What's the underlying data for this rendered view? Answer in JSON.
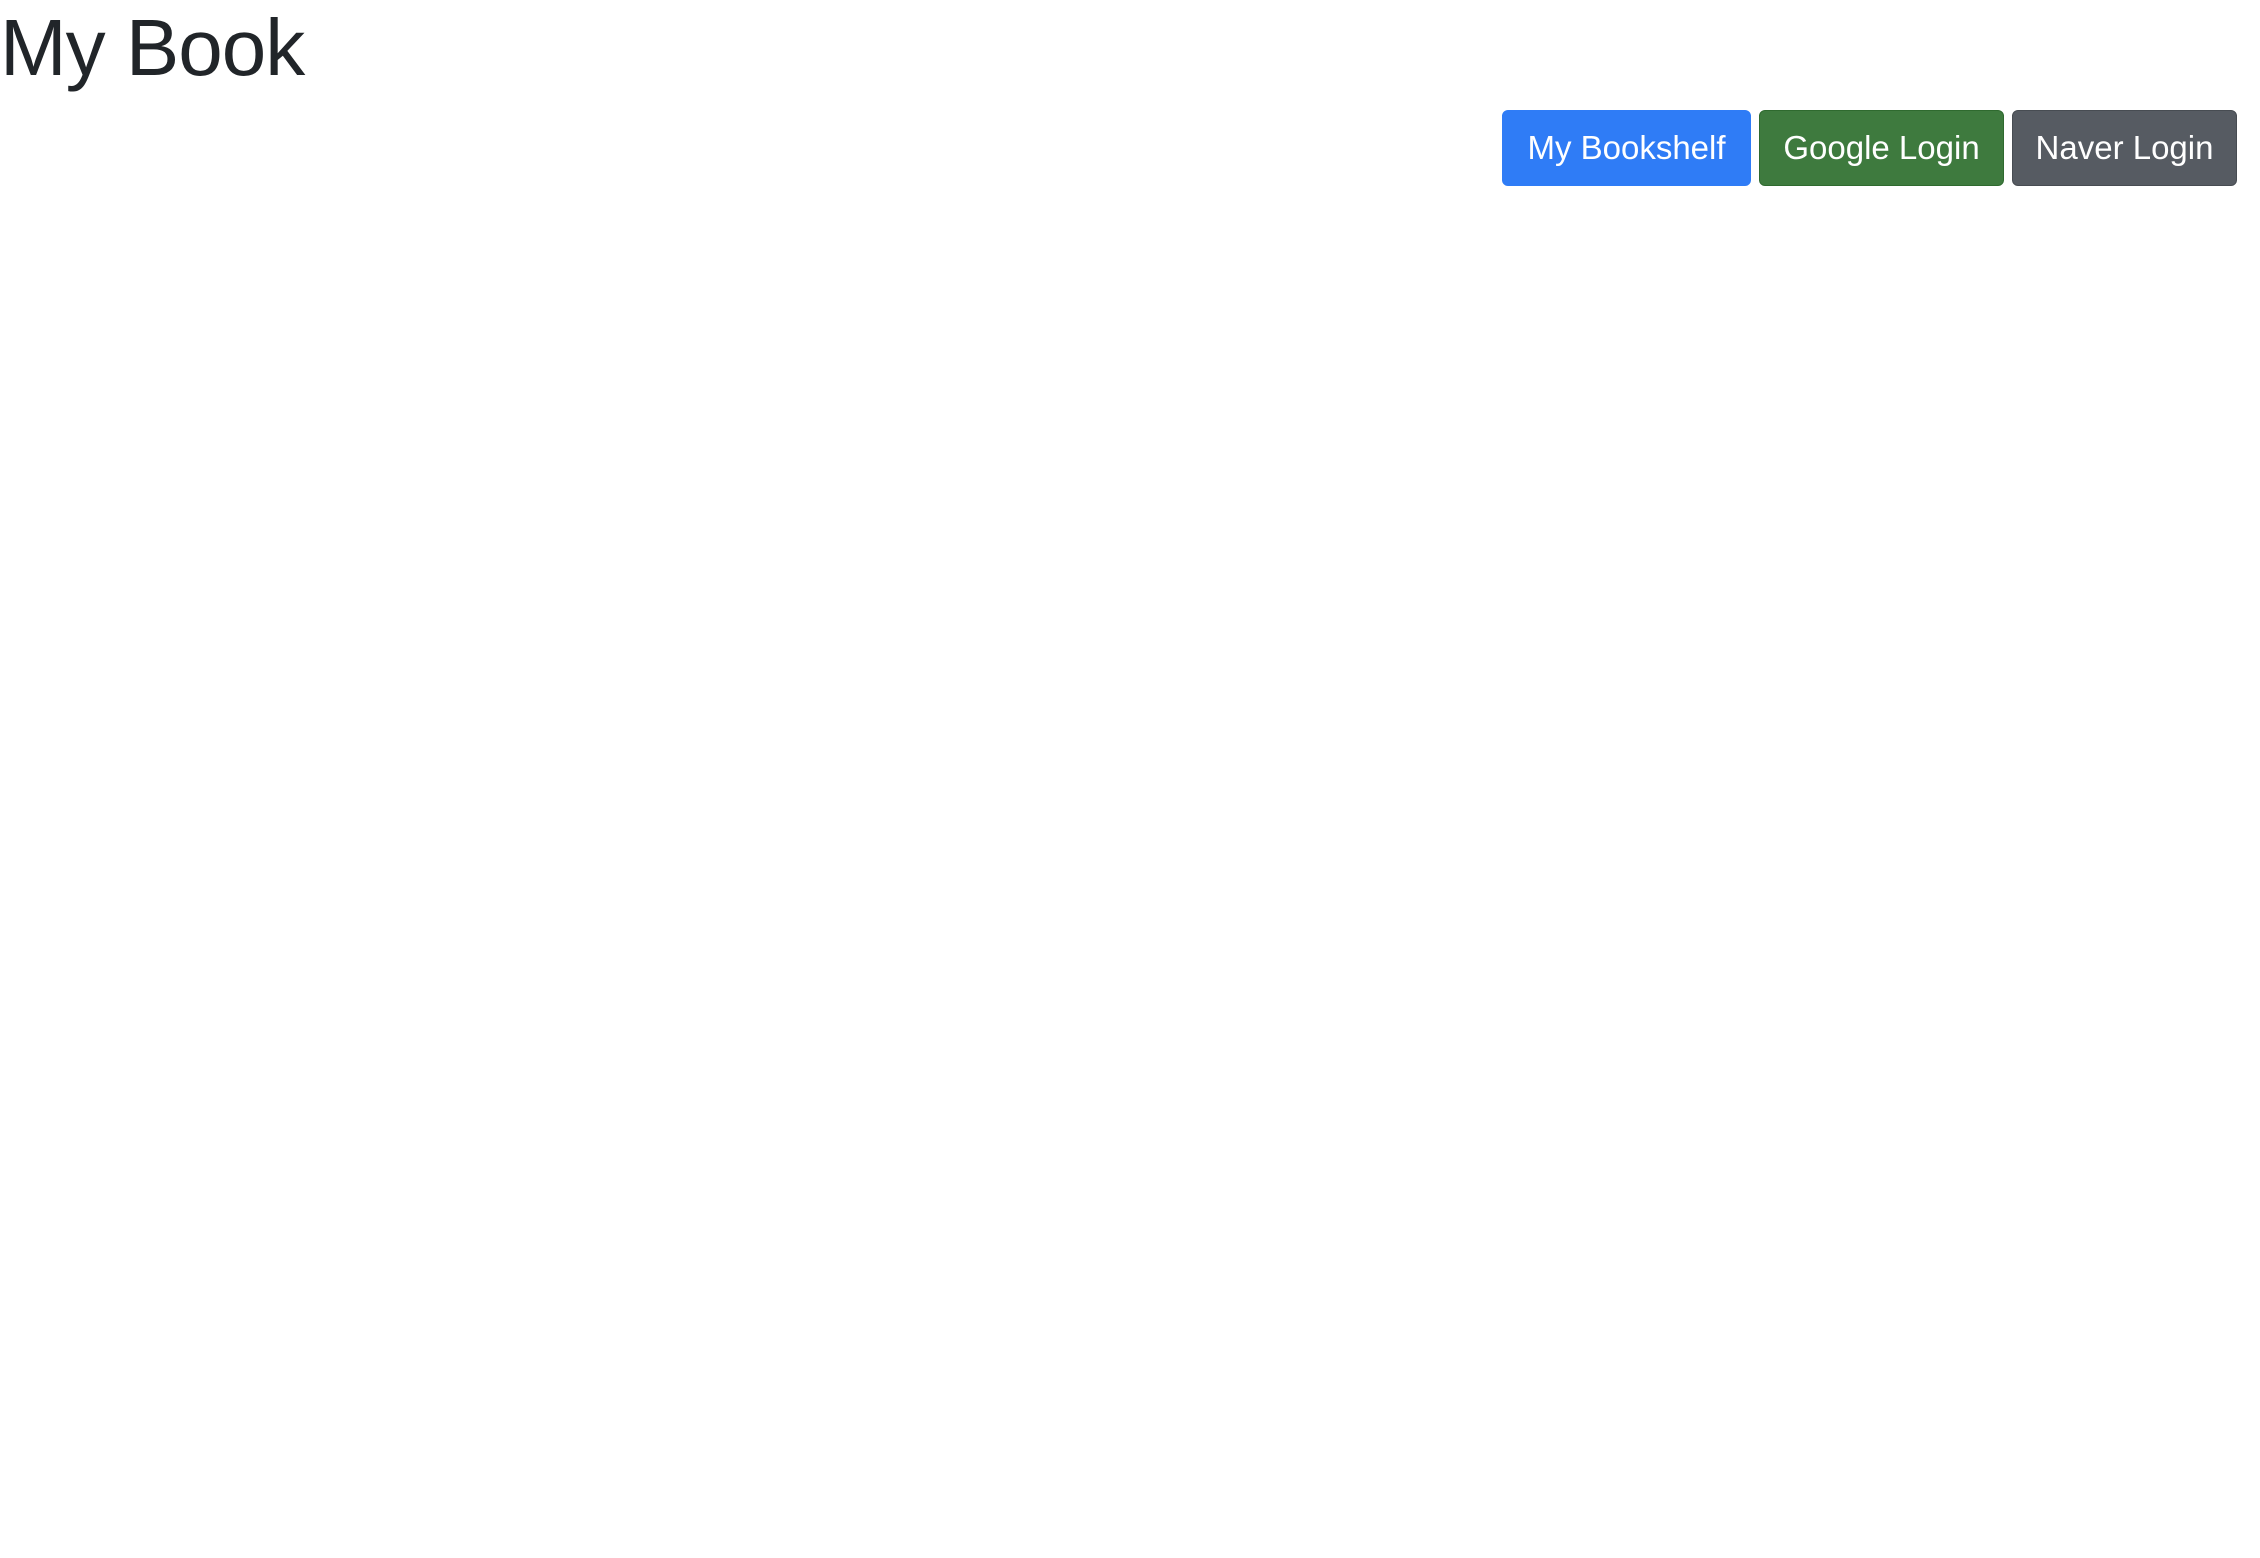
{
  "header": {
    "title": "My Book",
    "actions": {
      "bookshelf_label": "My Bookshelf",
      "google_login_label": "Google Login",
      "naver_login_label": "Naver Login"
    }
  },
  "colors": {
    "title_text": "#212529",
    "bookshelf_button": "#2f7cf6",
    "google_login_button": "#3e7a3e",
    "naver_login_button": "#565b62",
    "button_text": "#ffffff",
    "background": "#ffffff"
  }
}
